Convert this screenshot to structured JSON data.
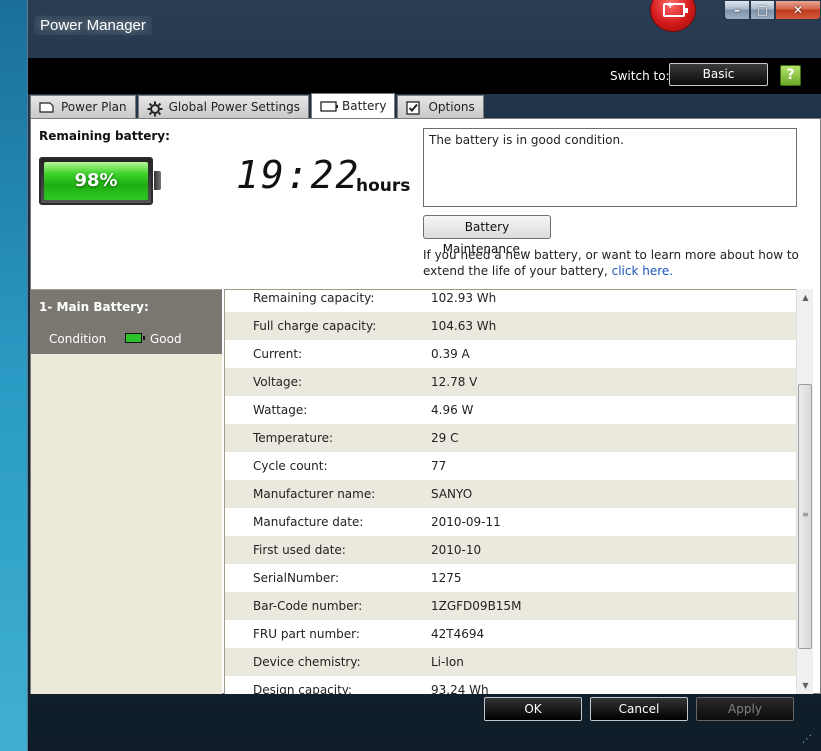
{
  "window": {
    "title": "Power Manager",
    "controls": {
      "minimize": "–",
      "maximize": "□",
      "close": "✕"
    }
  },
  "toolbar": {
    "switch_label": "Switch to:",
    "switch_button": "Basic",
    "help_icon": "?"
  },
  "tabs": [
    {
      "label": "Power Plan",
      "icon": "power-plan-icon"
    },
    {
      "label": "Global Power Settings",
      "icon": "gear-icon"
    },
    {
      "label": "Battery",
      "icon": "battery-icon",
      "active": true
    },
    {
      "label": "Options",
      "icon": "checkbox-icon"
    }
  ],
  "battery": {
    "remaining_label": "Remaining battery:",
    "percent": "98%",
    "time": "19:22",
    "time_unit": "hours",
    "status_message": "The battery is in good condition.",
    "maintenance_button": "Battery Maintenance...",
    "help_text": "If you need a new battery, or want to learn more about how to extend the life of your battery,",
    "help_link": "click here."
  },
  "left_panel": {
    "battery_name": "1- Main Battery:",
    "condition_label": "Condition",
    "condition_value": "Good"
  },
  "details": [
    {
      "label": "Remaining capacity:",
      "value": "102.93 Wh"
    },
    {
      "label": "Full charge capacity:",
      "value": "104.63 Wh"
    },
    {
      "label": "Current:",
      "value": "0.39 A"
    },
    {
      "label": "Voltage:",
      "value": "12.78 V"
    },
    {
      "label": "Wattage:",
      "value": "4.96 W"
    },
    {
      "label": "Temperature:",
      "value": "29 C"
    },
    {
      "label": "Cycle count:",
      "value": "77"
    },
    {
      "label": "Manufacturer name:",
      "value": "SANYO"
    },
    {
      "label": "Manufacture date:",
      "value": "2010-09-11"
    },
    {
      "label": "First used date:",
      "value": "2010-10"
    },
    {
      "label": "SerialNumber:",
      "value": "1275"
    },
    {
      "label": "Bar-Code number:",
      "value": "1ZGFD09B15M"
    },
    {
      "label": "FRU part number:",
      "value": "42T4694"
    },
    {
      "label": "Device chemistry:",
      "value": "Li-Ion"
    },
    {
      "label": "Design capacity:",
      "value": "93.24 Wh"
    }
  ],
  "footer": {
    "ok": "OK",
    "cancel": "Cancel",
    "apply": "Apply"
  },
  "colors": {
    "accent_green": "#2fc922",
    "link_blue": "#1a56b8",
    "titlebar_dark": "#000000"
  }
}
